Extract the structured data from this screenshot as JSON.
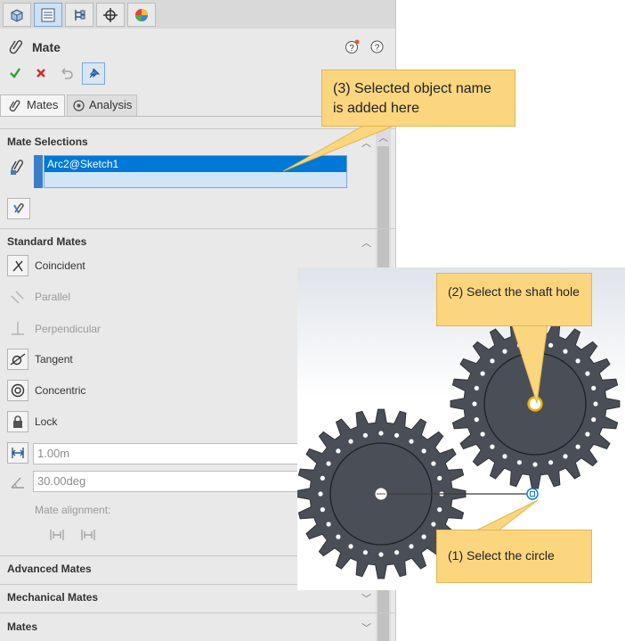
{
  "tabs": [
    {
      "icon": "feature-manager-icon"
    },
    {
      "icon": "property-manager-icon"
    },
    {
      "icon": "configuration-manager-icon"
    },
    {
      "icon": "dimxpert-icon"
    },
    {
      "icon": "display-manager-icon"
    }
  ],
  "header": {
    "title": "Mate"
  },
  "subtabs": {
    "mates": "Mates",
    "analysis": "Analysis"
  },
  "selections": {
    "section": "Mate Selections",
    "item": "Arc2@Sketch1"
  },
  "standard": {
    "section": "Standard Mates",
    "coincident": "Coincident",
    "parallel": "Parallel",
    "perpendicular": "Perpendicular",
    "tangent": "Tangent",
    "concentric": "Concentric",
    "lock": "Lock",
    "distance_value": "1.00m",
    "angle_value": "30.00deg",
    "alignment": "Mate alignment:"
  },
  "sections": {
    "advanced": "Advanced Mates",
    "mechanical": "Mechanical Mates",
    "mates": "Mates"
  },
  "callouts": {
    "three": "(3) Selected object name is added here",
    "two": "(2) Select the shaft hole",
    "one": "(1) Select the circle"
  },
  "colors": {
    "selection": "#0078d7",
    "callout": "#fbd67f",
    "gear": "#4a4f57"
  }
}
